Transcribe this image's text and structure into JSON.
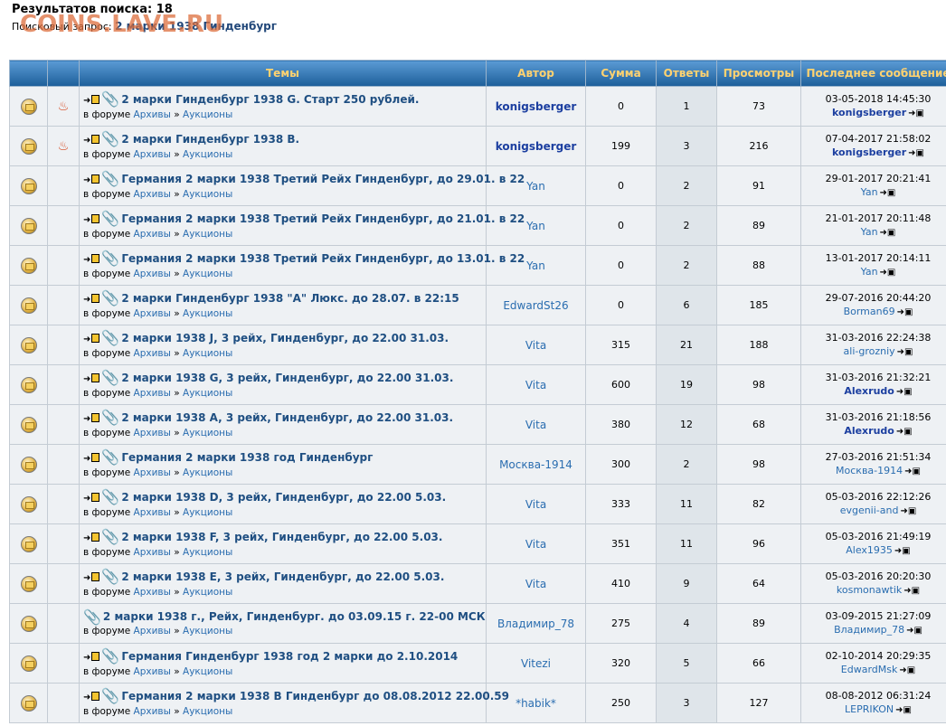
{
  "header": {
    "results_title": "Результатов поиска: 18",
    "query_label": "Поисковый запрос:",
    "query_term": "2 марки 1938 Гинденбург",
    "watermark": "COINS.LAVE.RU"
  },
  "columns": {
    "topics": "Темы",
    "author": "Автор",
    "sum": "Сумма",
    "replies": "Ответы",
    "views": "Просмотры",
    "last": "Последнее сообщение"
  },
  "labels": {
    "in_forum": "в форуме",
    "sep": "»"
  },
  "rows": [
    {
      "title": "2 марки Гинденбург 1938 G. Старт 250 рублей.",
      "hot": true,
      "newpost": true,
      "forum": "Архивы",
      "subforum": "Аукционы",
      "author": "konigsberger",
      "author_bold": true,
      "sum": "0",
      "replies": "1",
      "views": "73",
      "last_date": "03-05-2018 14:45:30",
      "last_author": "konigsberger",
      "last_bold": true
    },
    {
      "title": "2 марки Гинденбург 1938 В.",
      "hot": true,
      "newpost": true,
      "forum": "Архивы",
      "subforum": "Аукционы",
      "author": "konigsberger",
      "author_bold": true,
      "sum": "199",
      "replies": "3",
      "views": "216",
      "last_date": "07-04-2017 21:58:02",
      "last_author": "konigsberger",
      "last_bold": true
    },
    {
      "title": "Германия 2 марки 1938 Третий Рейх Гинденбург, до 29.01. в 22",
      "hot": false,
      "newpost": true,
      "forum": "Архивы",
      "subforum": "Аукционы",
      "author": "Yan",
      "author_bold": false,
      "sum": "0",
      "replies": "2",
      "views": "91",
      "last_date": "29-01-2017 20:21:41",
      "last_author": "Yan",
      "last_bold": false
    },
    {
      "title": "Германия 2 марки 1938 Третий Рейх Гинденбург, до 21.01. в 22",
      "hot": false,
      "newpost": true,
      "forum": "Архивы",
      "subforum": "Аукционы",
      "author": "Yan",
      "author_bold": false,
      "sum": "0",
      "replies": "2",
      "views": "89",
      "last_date": "21-01-2017 20:11:48",
      "last_author": "Yan",
      "last_bold": false
    },
    {
      "title": "Германия 2 марки 1938 Третий Рейх Гинденбург, до 13.01. в 22",
      "hot": false,
      "newpost": true,
      "forum": "Архивы",
      "subforum": "Аукционы",
      "author": "Yan",
      "author_bold": false,
      "sum": "0",
      "replies": "2",
      "views": "88",
      "last_date": "13-01-2017 20:14:11",
      "last_author": "Yan",
      "last_bold": false
    },
    {
      "title": "2 марки Гинденбург 1938 \"А\" Люкс. до 28.07. в 22:15",
      "hot": false,
      "newpost": true,
      "forum": "Архивы",
      "subforum": "Аукционы",
      "author": "EdwardSt26",
      "author_bold": false,
      "sum": "0",
      "replies": "6",
      "views": "185",
      "last_date": "29-07-2016 20:44:20",
      "last_author": "Borman69",
      "last_bold": false
    },
    {
      "title": "2 марки 1938 J, 3 рейх, Гинденбург, до 22.00 31.03.",
      "hot": false,
      "newpost": true,
      "forum": "Архивы",
      "subforum": "Аукционы",
      "author": "Vita",
      "author_bold": false,
      "sum": "315",
      "replies": "21",
      "views": "188",
      "last_date": "31-03-2016 22:24:38",
      "last_author": "ali-grozniy",
      "last_bold": false
    },
    {
      "title": "2 марки 1938 G, 3 рейх, Гинденбург, до 22.00 31.03.",
      "hot": false,
      "newpost": true,
      "forum": "Архивы",
      "subforum": "Аукционы",
      "author": "Vita",
      "author_bold": false,
      "sum": "600",
      "replies": "19",
      "views": "98",
      "last_date": "31-03-2016 21:32:21",
      "last_author": "Alexrudo",
      "last_bold": true
    },
    {
      "title": "2 марки 1938 A, 3 рейх, Гинденбург, до 22.00 31.03.",
      "hot": false,
      "newpost": true,
      "forum": "Архивы",
      "subforum": "Аукционы",
      "author": "Vita",
      "author_bold": false,
      "sum": "380",
      "replies": "12",
      "views": "68",
      "last_date": "31-03-2016 21:18:56",
      "last_author": "Alexrudo",
      "last_bold": true
    },
    {
      "title": "Германия 2 марки 1938 год Гинденбург",
      "hot": false,
      "newpost": true,
      "forum": "Архивы",
      "subforum": "Аукционы",
      "author": "Москва-1914",
      "author_bold": false,
      "sum": "300",
      "replies": "2",
      "views": "98",
      "last_date": "27-03-2016 21:51:34",
      "last_author": "Москва-1914",
      "last_bold": false
    },
    {
      "title": "2 марки 1938 D, 3 рейх, Гинденбург, до 22.00 5.03.",
      "hot": false,
      "newpost": true,
      "forum": "Архивы",
      "subforum": "Аукционы",
      "author": "Vita",
      "author_bold": false,
      "sum": "333",
      "replies": "11",
      "views": "82",
      "last_date": "05-03-2016 22:12:26",
      "last_author": "evgenii-and",
      "last_bold": false
    },
    {
      "title": "2 марки 1938 F, 3 рейх, Гинденбург, до 22.00 5.03.",
      "hot": false,
      "newpost": true,
      "forum": "Архивы",
      "subforum": "Аукционы",
      "author": "Vita",
      "author_bold": false,
      "sum": "351",
      "replies": "11",
      "views": "96",
      "last_date": "05-03-2016 21:49:19",
      "last_author": "Alex1935",
      "last_bold": false
    },
    {
      "title": "2 марки 1938 E, 3 рейх, Гинденбург, до 22.00 5.03.",
      "hot": false,
      "newpost": true,
      "forum": "Архивы",
      "subforum": "Аукционы",
      "author": "Vita",
      "author_bold": false,
      "sum": "410",
      "replies": "9",
      "views": "64",
      "last_date": "05-03-2016 20:20:30",
      "last_author": "kosmonawtik",
      "last_bold": false
    },
    {
      "title": "2 марки 1938 г., Рейх, Гинденбург. до 03.09.15 г. 22-00 МСК",
      "hot": false,
      "newpost": false,
      "forum": "Архивы",
      "subforum": "Аукционы",
      "author": "Владимир_78",
      "author_bold": false,
      "sum": "275",
      "replies": "4",
      "views": "89",
      "last_date": "03-09-2015 21:27:09",
      "last_author": "Владимир_78",
      "last_bold": false
    },
    {
      "title": "Германия Гинденбург 1938 год 2 марки до 2.10.2014",
      "hot": false,
      "newpost": true,
      "clip": false,
      "forum": "Архивы",
      "subforum": "Аукционы",
      "author": "Vitezi",
      "author_bold": false,
      "sum": "320",
      "replies": "5",
      "views": "66",
      "last_date": "02-10-2014 20:29:35",
      "last_author": "EdwardMsk",
      "last_bold": false
    },
    {
      "title": "Германия 2 марки 1938 В Гинденбург до 08.08.2012 22.00.59",
      "hot": false,
      "newpost": true,
      "forum": "Архивы",
      "subforum": "Аукционы",
      "author": "*habik*",
      "author_bold": false,
      "sum": "250",
      "replies": "3",
      "views": "127",
      "last_date": "08-08-2012 06:31:24",
      "last_author": "LEPRIKON",
      "last_bold": false
    }
  ]
}
